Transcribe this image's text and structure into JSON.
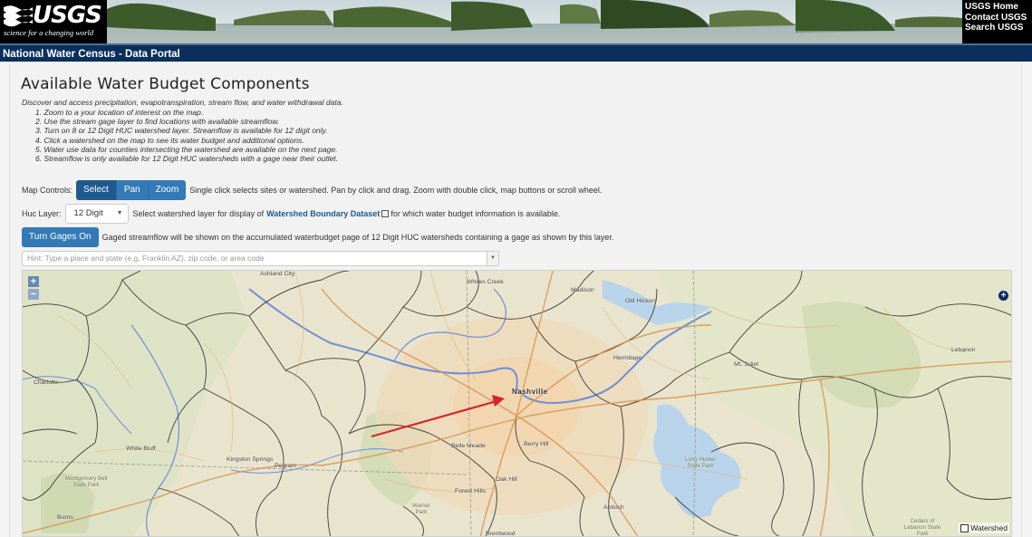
{
  "header": {
    "logo_text": "USGS",
    "logo_tagline": "science for a changing world",
    "links": [
      "USGS Home",
      "Contact USGS",
      "Search USGS"
    ],
    "subtitle": "National Water Census - Data Portal"
  },
  "main": {
    "title": "Available Water Budget Components",
    "intro": "Discover and access precipitation, evapotranspiration, stream flow, and water withdrawal data.",
    "steps": [
      "1. Zoom to a your location of interest on the map.",
      "2. Use the stream gage layer to find locations with available streamflow.",
      "3. Turn on 8 or 12 Digit HUC watershed layer. Streamflow is available for 12 digit only.",
      "4. Click a watershed on the map to see its water budget and additional options.",
      "5. Water use data for counties intersecting the watershed are available on the next page.",
      "6. Streamflow is only available for 12 Digit HUC watersheds with a gage near their outlet."
    ]
  },
  "controls": {
    "map_controls_label": "Map Controls:",
    "buttons": [
      "Select",
      "Pan",
      "Zoom"
    ],
    "active_button": "Select",
    "map_controls_help": "Single click selects sites or watershed. Pan by click and drag. Zoom with double click, map buttons or scroll wheel.",
    "huc_label": "Huc Layer:",
    "huc_value": "12 Digit",
    "huc_help_before": "Select watershed layer for display of",
    "huc_link": "Watershed Boundary Dataset",
    "huc_help_after": "for which water budget information is available.",
    "gages_button": "Turn Gages On",
    "gages_help": "Gaged streamflow will be shown on the accumulated waterbudget page of 12 Digit HUC watersheds containing a gage as shown by this layer.",
    "search_placeholder": "Hint: Type a place and state (e.g. Franklin AZ), zip code, or area code"
  },
  "map": {
    "zoom_in": "+",
    "zoom_out": "−",
    "expand": "+",
    "legend_label": "Watershed",
    "places": {
      "nashville": "Nashville",
      "ashland_city": "Ashland City",
      "whites_creek": "Whites Creek",
      "madison": "Madison",
      "old_hickory": "Old Hickory",
      "hermitage": "Hermitage",
      "mt_juliet": "Mt. Juliet",
      "lebanon": "Lebanon",
      "charlotte": "Charlotte",
      "white_bluff": "White Bluff",
      "kingston_springs": "Kingston Springs",
      "pegram": "Pegram",
      "belle_meade": "Belle Meade",
      "berry_hill": "Berry Hill",
      "oak_hill": "Oak Hill",
      "forest_hills": "Forest Hills",
      "antioch": "Antioch",
      "brentwood": "Brentwood",
      "burns": "Burns",
      "montgomery_park": "Montgomery Bell State Park",
      "long_hunter_park": "Long Hunter State Park",
      "cedars_park": "Cedars of Lebanon State Park",
      "warner_park": "Warner Park"
    }
  },
  "colors": {
    "header_bar": "#0a2f5c",
    "button": "#337ab7",
    "arrow": "#d8232a"
  }
}
